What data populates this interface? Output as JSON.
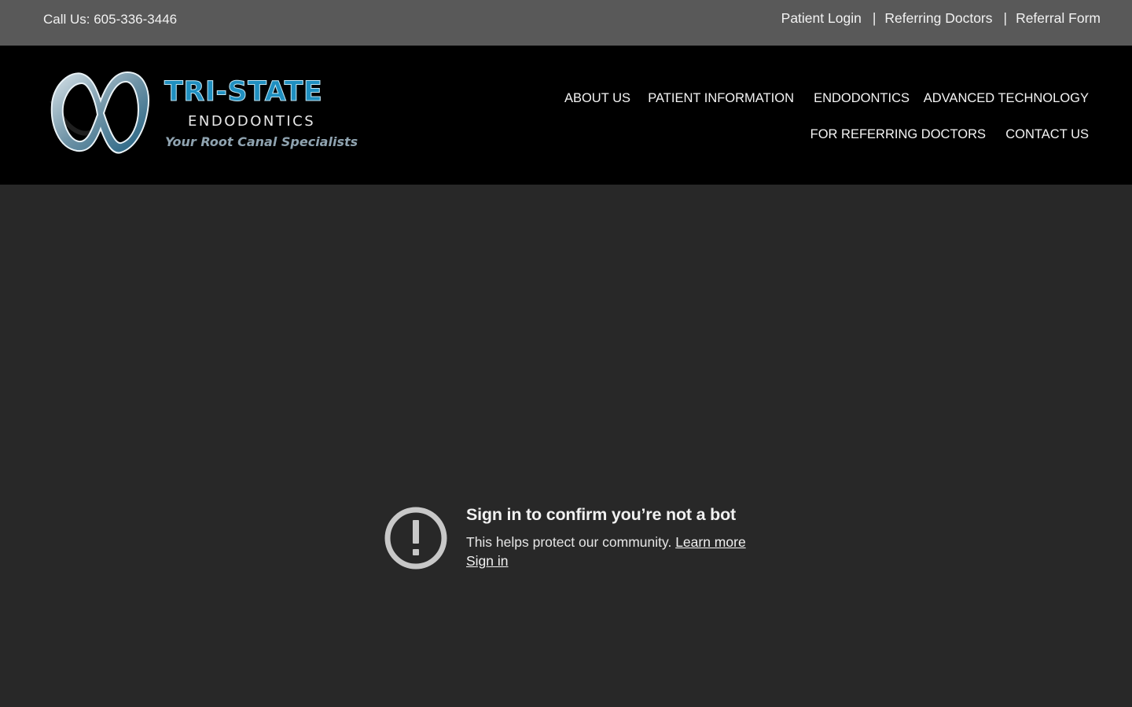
{
  "topbar": {
    "phone": "Call Us: 605-336-3446",
    "links": [
      "Patient Login",
      "Referring Doctors",
      "Referral Form"
    ],
    "separator": "|"
  },
  "logo": {
    "title": "TRI-STATE",
    "subtitle": "ENDODONTICS",
    "tagline": "Your Root Canal Specialists"
  },
  "nav": {
    "items": [
      "ABOUT US",
      "PATIENT INFORMATION",
      "ENDODONTICS",
      "ADVANCED TECHNOLOGY",
      "FOR REFERRING DOCTORS",
      "CONTACT US"
    ]
  },
  "notice": {
    "icon": "alert-circle-icon",
    "title": "Sign in to confirm you’re not a bot",
    "message": "This helps protect our community.",
    "learn_more": "Learn more",
    "sign_in": "Sign in"
  },
  "colors": {
    "topbar_bg": "#595959",
    "header_bg": "#000000",
    "content_bg": "#282828",
    "logo_blue": "#1f8fc0"
  }
}
